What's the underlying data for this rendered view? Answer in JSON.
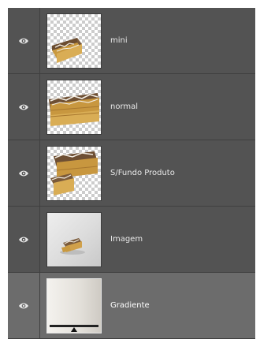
{
  "layers_panel": {
    "layers": [
      {
        "name": "mini",
        "visible": true,
        "selected": false,
        "thumbnail": "cake-slice-on-transparency",
        "eye_icon": "eye-icon"
      },
      {
        "name": "normal",
        "visible": true,
        "selected": false,
        "thumbnail": "cake-slice-closeup",
        "eye_icon": "eye-icon"
      },
      {
        "name": "S/Fundo Produto",
        "visible": true,
        "selected": false,
        "thumbnail": "cake-slices-on-transparency",
        "eye_icon": "eye-icon"
      },
      {
        "name": "Imagem",
        "visible": true,
        "selected": false,
        "thumbnail": "product-photo",
        "eye_icon": "eye-icon"
      },
      {
        "name": "Gradiente",
        "visible": true,
        "selected": true,
        "thumbnail": "gradient-fill",
        "eye_icon": "eye-icon"
      }
    ]
  }
}
